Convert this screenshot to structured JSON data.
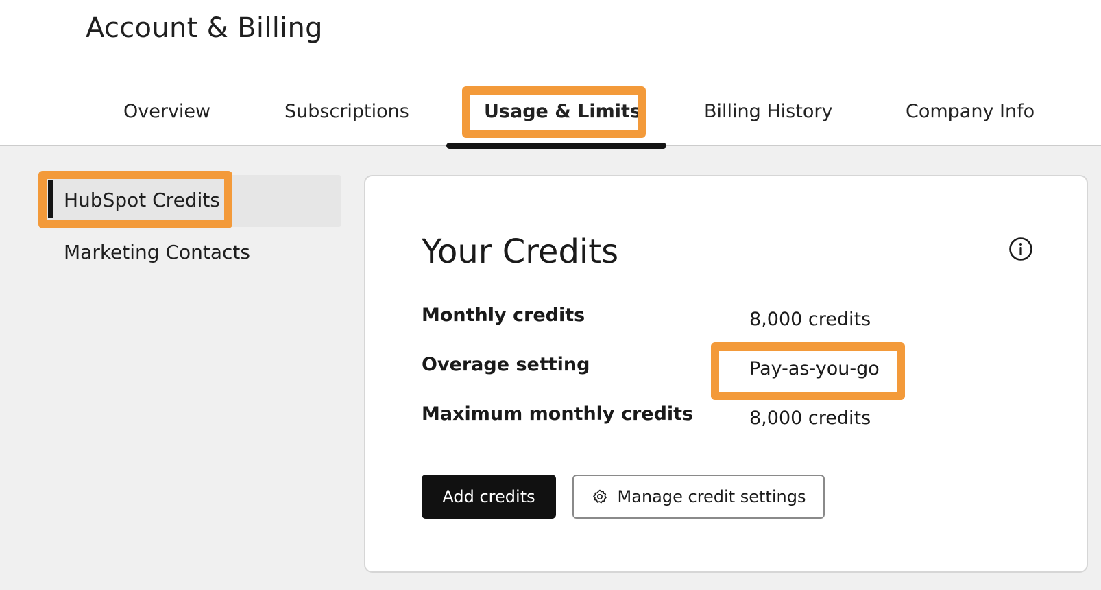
{
  "header": {
    "title": "Account & Billing"
  },
  "tabs": [
    {
      "label": "Overview",
      "active": false
    },
    {
      "label": "Subscriptions",
      "active": false
    },
    {
      "label": "Usage & Limits",
      "active": true
    },
    {
      "label": "Billing History",
      "active": false
    },
    {
      "label": "Company Info",
      "active": false
    }
  ],
  "sidebar": {
    "items": [
      {
        "label": "HubSpot Credits",
        "active": true
      },
      {
        "label": "Marketing Contacts",
        "active": false
      }
    ]
  },
  "card": {
    "title": "Your Credits",
    "rows": [
      {
        "label": "Monthly credits",
        "value": "8,000 credits"
      },
      {
        "label": "Overage setting",
        "value": "Pay-as-you-go"
      },
      {
        "label": "Maximum monthly credits",
        "value": "8,000 credits"
      }
    ],
    "add_button": "Add credits",
    "manage_button": "Manage credit settings"
  },
  "icons": {
    "info": "info-icon",
    "gear": "gear-icon"
  },
  "colors": {
    "highlight": "#f39a3a",
    "primary_button": "#111111",
    "active_indicator": "#141414"
  }
}
